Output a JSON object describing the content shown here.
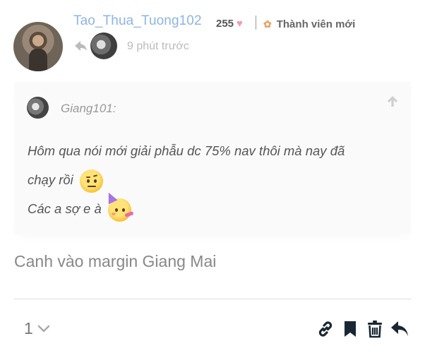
{
  "post": {
    "username": "Tao_Thua_Tuong102",
    "score": "255",
    "member_status": "Thành viên mới",
    "time": "9 phút trước",
    "quote": {
      "author": "Giang101:",
      "line1": "Hôm qua nói mới giải phẫu dc 75% nav thôi mà nay đã",
      "line2": "chạy rồi",
      "line3": "Các a sợ e à"
    },
    "body": "Canh vào margin Giang Mai",
    "like_count": "1"
  },
  "icons": {
    "heart": "heart-icon",
    "member": "new-member-icon",
    "reply_to": "reply-arrow-icon",
    "quote_up": "arrow-up-icon",
    "emoji1": "face-with-raised-eyebrow",
    "emoji2": "partying-face",
    "likes_toggle": "chevron-down-icon",
    "link": "link-icon",
    "bookmark": "bookmark-icon",
    "delete": "trash-icon",
    "reply": "reply-icon"
  },
  "colors": {
    "username": "#8eb4e6",
    "heart": "#f39ab3",
    "member_icon": "#e8a46b",
    "action_icons": "#1a2733"
  }
}
